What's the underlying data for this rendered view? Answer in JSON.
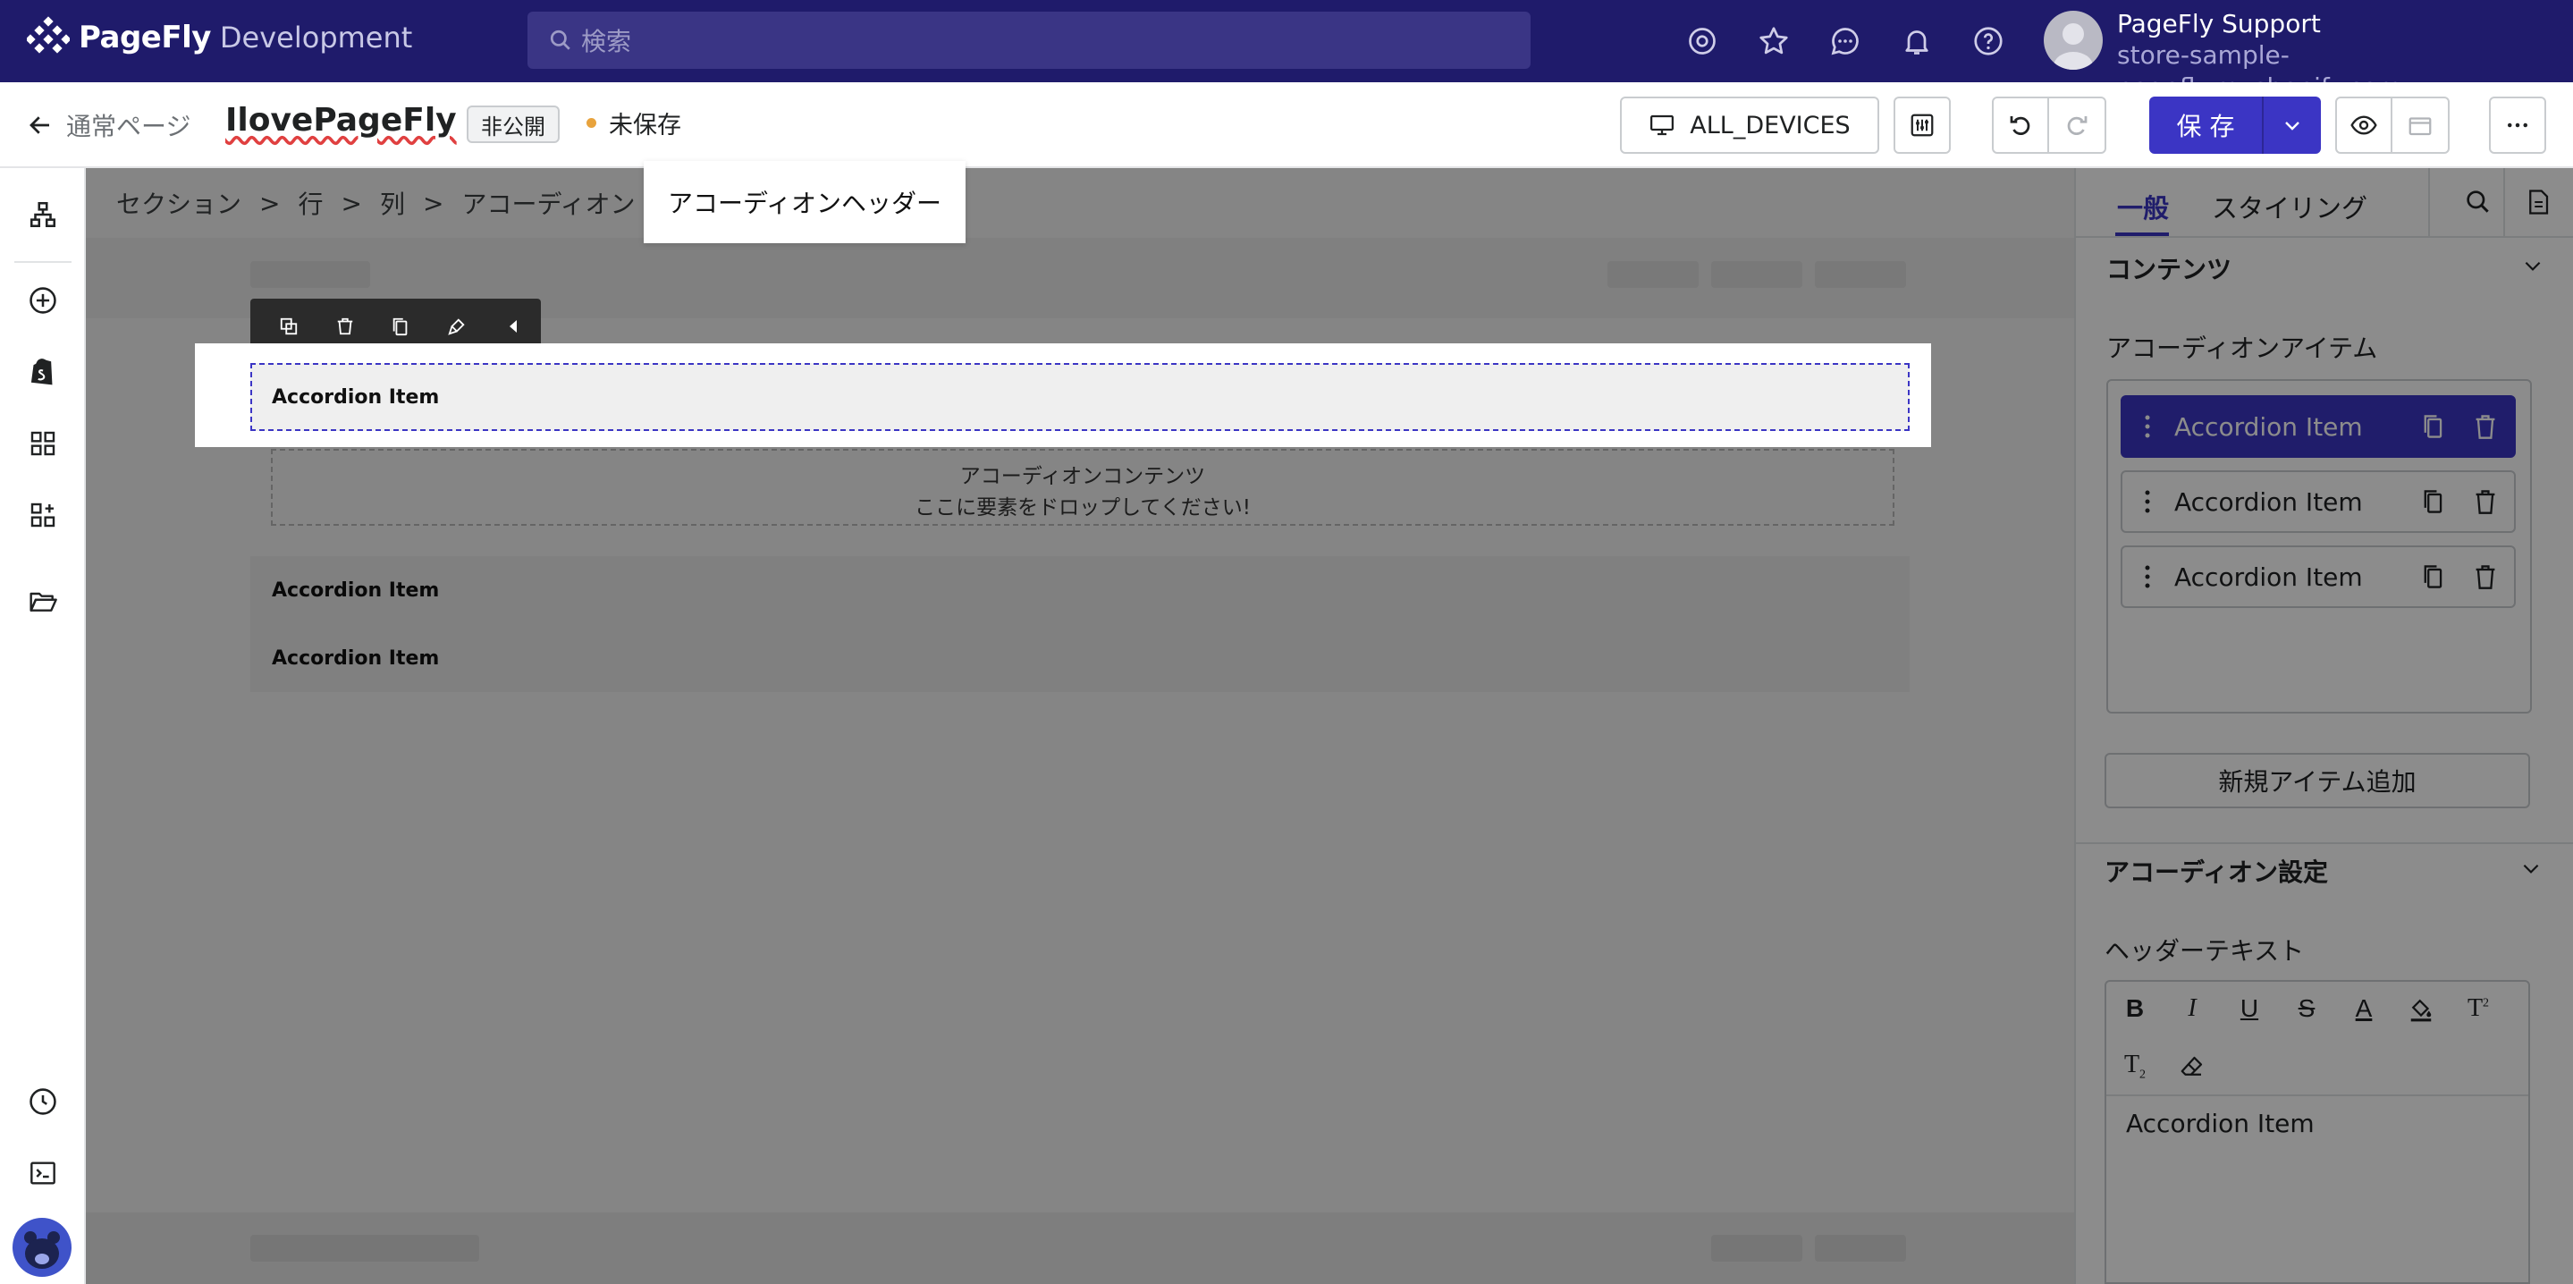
{
  "topbar": {
    "brand": "PageFly",
    "brand_sub": "Development",
    "search_placeholder": "検索",
    "user_name": "PageFly Support",
    "user_store": "store-sample-pagefly.myshopify.com",
    "icons": [
      "settings-icon",
      "star-icon",
      "chat-icon",
      "bell-icon",
      "help-icon"
    ]
  },
  "editor_bar": {
    "back_label": "通常ページ",
    "page_title": "IlovePageFly",
    "visibility_badge": "非公開",
    "save_status": "未保存",
    "device_label": "ALL_DEVICES",
    "save_label": "保 存"
  },
  "breadcrumb": {
    "items": [
      "セクション",
      "行",
      "列",
      "アコーディオン"
    ],
    "current": "アコーディオンヘッダー"
  },
  "canvas": {
    "selected_item": "Accordion Item",
    "content_placeholder_1": "アコーディオンコンテンツ",
    "content_placeholder_2": "ここに要素をドロップしてください!",
    "items": [
      "Accordion Item",
      "Accordion Item"
    ]
  },
  "right_panel": {
    "tab_general": "一般",
    "tab_styling": "スタイリング",
    "section_content": "コンテンツ",
    "accordion_items_label": "アコーディオンアイテム",
    "items": [
      "Accordion Item",
      "Accordion Item",
      "Accordion Item"
    ],
    "add_item_button": "新規アイテム追加",
    "section_settings": "アコーディオン設定",
    "header_text_label": "ヘッダーテキスト",
    "editor_value": "Accordion Item"
  },
  "colors": {
    "primary": "#3b35c4",
    "topbar": "#1f1b6b",
    "unsaved_dot": "#e8a33d"
  }
}
